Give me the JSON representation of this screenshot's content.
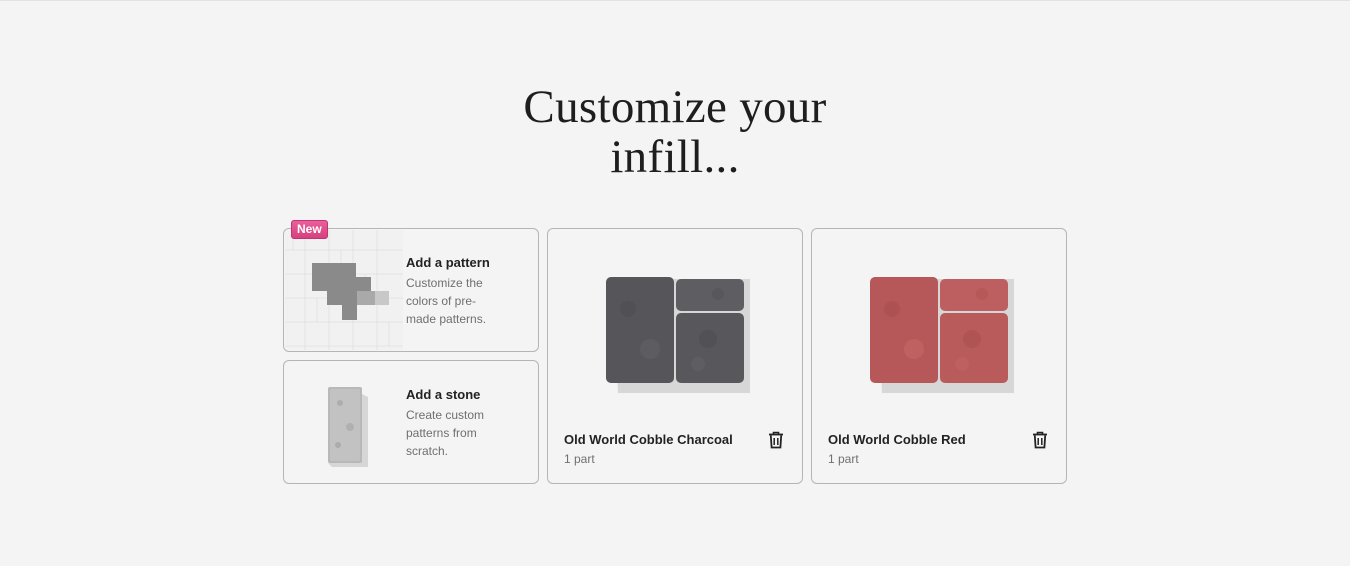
{
  "heading": {
    "line1": "Customize your",
    "line2": "infill..."
  },
  "pattern_card": {
    "badge": "New",
    "title": "Add a pattern",
    "description": "Customize the colors of pre-made patterns."
  },
  "stone_card": {
    "title": "Add a stone",
    "description": "Create custom patterns from scratch."
  },
  "products": [
    {
      "name": "Old World Cobble Charcoal",
      "count": "1 part",
      "color": "#58585c",
      "icon": "trash-icon"
    },
    {
      "name": "Old World Cobble Red",
      "count": "1 part",
      "color": "#b95b5b",
      "icon": "trash-icon"
    }
  ]
}
